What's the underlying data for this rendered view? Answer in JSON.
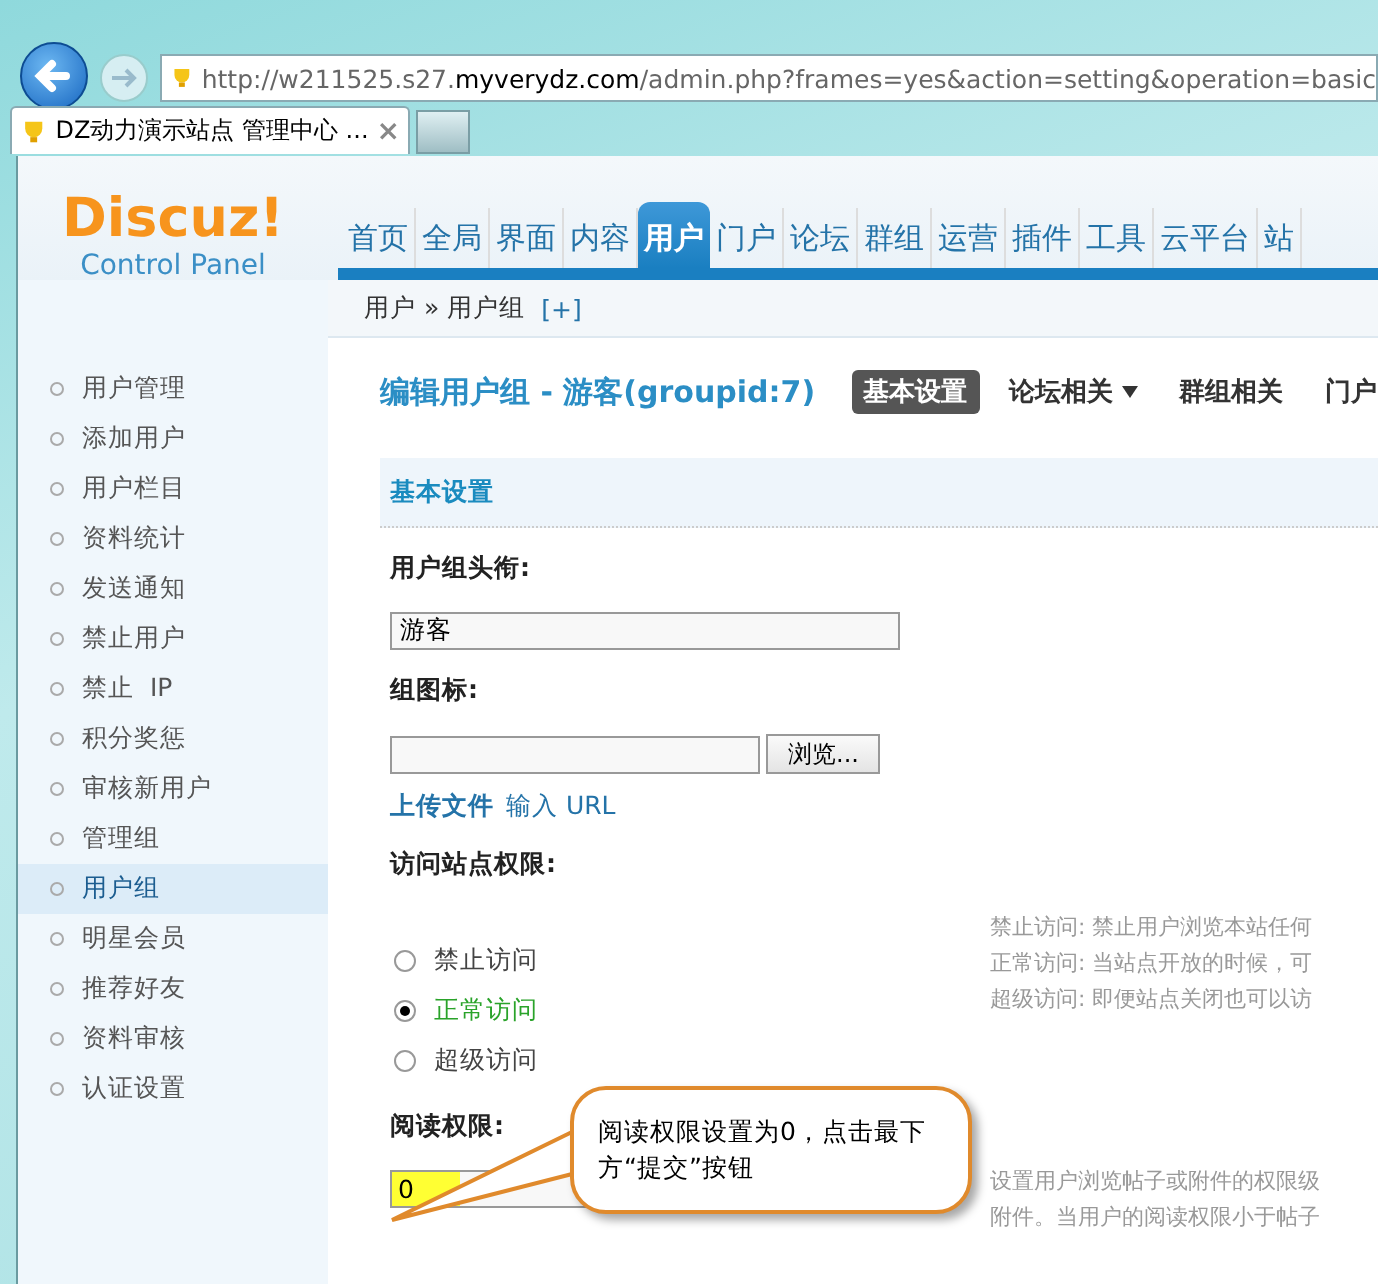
{
  "browser": {
    "address": "http://w211525.s27.**myverydz.com**/admin.php?frames=yes&action=setting&operation=basic",
    "tab": {
      "title": "DZ动力演示站点 管理中心 ...",
      "close": "×"
    }
  },
  "logo": {
    "title": "Discuz!",
    "subtitle": "Control Panel"
  },
  "nav": [
    {
      "label": "首页",
      "selected": false
    },
    {
      "label": "全局",
      "selected": false
    },
    {
      "label": "界面",
      "selected": false
    },
    {
      "label": "内容",
      "selected": false
    },
    {
      "label": "用户",
      "selected": true
    },
    {
      "label": "门户",
      "selected": false
    },
    {
      "label": "论坛",
      "selected": false
    },
    {
      "label": "群组",
      "selected": false
    },
    {
      "label": "运营",
      "selected": false
    },
    {
      "label": "插件",
      "selected": false
    },
    {
      "label": "工具",
      "selected": false
    },
    {
      "label": "云平台",
      "selected": false
    },
    {
      "label": "站",
      "selected": false
    }
  ],
  "breadcrumb": {
    "path": "用户 » 用户组",
    "add": "[+]"
  },
  "sidebar": [
    {
      "label": "用户管理",
      "selected": false
    },
    {
      "label": "添加用户",
      "selected": false
    },
    {
      "label": "用户栏目",
      "selected": false
    },
    {
      "label": "资料统计",
      "selected": false
    },
    {
      "label": "发送通知",
      "selected": false
    },
    {
      "label": "禁止用户",
      "selected": false
    },
    {
      "label": "禁止  IP",
      "selected": false
    },
    {
      "label": "积分奖惩",
      "selected": false
    },
    {
      "label": "审核新用户",
      "selected": false
    },
    {
      "label": "管理组",
      "selected": false
    },
    {
      "label": "用户组",
      "selected": true
    },
    {
      "label": "明星会员",
      "selected": false
    },
    {
      "label": "推荐好友",
      "selected": false
    },
    {
      "label": "资料审核",
      "selected": false
    },
    {
      "label": "认证设置",
      "selected": false
    }
  ],
  "page_title": "编辑用户组 - 游客(groupid:7)",
  "subtabs": [
    {
      "label": "基本设置",
      "selected": true,
      "kind": "tab"
    },
    {
      "label": "论坛相关",
      "selected": false,
      "kind": "dropdown"
    },
    {
      "label": "群组相关",
      "selected": false,
      "kind": "tab"
    },
    {
      "label": "门户",
      "selected": false,
      "kind": "tab"
    }
  ],
  "section_title": "基本设置",
  "group_title": {
    "label": "用户组头衔:",
    "value": "游客"
  },
  "group_icon": {
    "label": "组图标:",
    "browse": "浏览...",
    "upload_link": "上传文件",
    "url_link": "输入 URL"
  },
  "access": {
    "label": "访问站点权限:",
    "options": [
      {
        "label": "禁止访问",
        "selected": false
      },
      {
        "label": "正常访问",
        "selected": true
      },
      {
        "label": "超级访问",
        "selected": false
      }
    ],
    "help": [
      "禁止访问: 禁止用户浏览本站任何",
      "正常访问: 当站点开放的时候，可",
      "超级访问: 即便站点关闭也可以访"
    ]
  },
  "read_permission": {
    "label": "阅读权限:",
    "value": "0",
    "help": [
      "设置用户浏览帖子或附件的权限级",
      "附件。当用户的阅读权限小于帖子"
    ]
  },
  "callout": "阅读权限设置为0，点击最下方“提交”按钮"
}
